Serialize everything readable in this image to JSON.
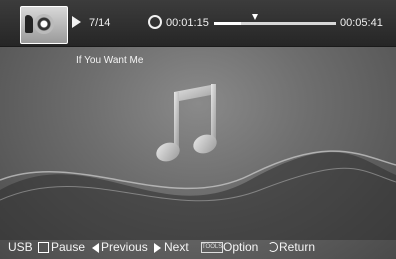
{
  "player": {
    "track_counter": "7/14",
    "elapsed_time": "00:01:15",
    "total_time": "00:05:41",
    "progress": 0.22,
    "song_title": "If You Want Me"
  },
  "bottom_bar": {
    "source": "USB",
    "pause_label": "Pause",
    "previous_label": "Previous",
    "next_label": "Next",
    "tools_badge": "TOOLS",
    "option_label": "Option",
    "return_label": "Return"
  },
  "icons": [
    "album-art-icon",
    "play-icon",
    "repeat-icon",
    "music-note-icon",
    "pause-icon",
    "previous-icon",
    "next-icon",
    "tools-icon",
    "return-icon"
  ]
}
